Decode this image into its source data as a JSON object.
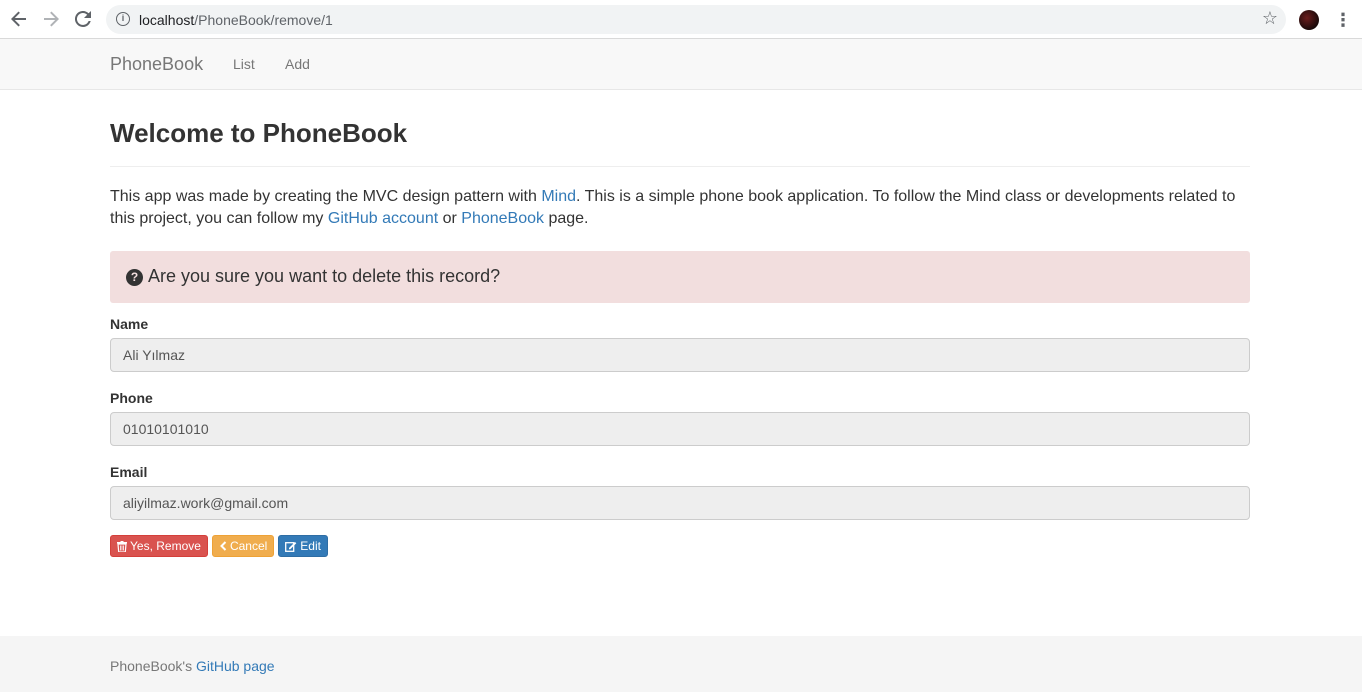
{
  "browser": {
    "url_host": "localhost",
    "url_path": "/PhoneBook/remove/1"
  },
  "navbar": {
    "brand": "PhoneBook",
    "links": [
      "List",
      "Add"
    ]
  },
  "main": {
    "title": "Welcome to PhoneBook",
    "intro": {
      "part1": "This app was made by creating the MVC design pattern with ",
      "link1": "Mind",
      "part2": ". This is a simple phone book application. To follow the Mind class or developments related to this project, you can follow my ",
      "link2": "GitHub account",
      "part3": " or ",
      "link3": "PhoneBook",
      "part4": " page."
    },
    "alert": "Are you sure you want to delete this record?",
    "fields": {
      "name_label": "Name",
      "name_value": "Ali Yılmaz",
      "phone_label": "Phone",
      "phone_value": "01010101010",
      "email_label": "Email",
      "email_value": "aliyilmaz.work@gmail.com"
    },
    "buttons": {
      "remove": "Yes, Remove",
      "cancel": "Cancel",
      "edit": "Edit"
    }
  },
  "footer": {
    "prefix": "PhoneBook's ",
    "link": "GitHub page"
  },
  "colors": {
    "link": "#337ab7",
    "danger": "#d9534f",
    "warning": "#f0ad4e",
    "primary": "#337ab7",
    "alert_bg": "#f2dede"
  }
}
